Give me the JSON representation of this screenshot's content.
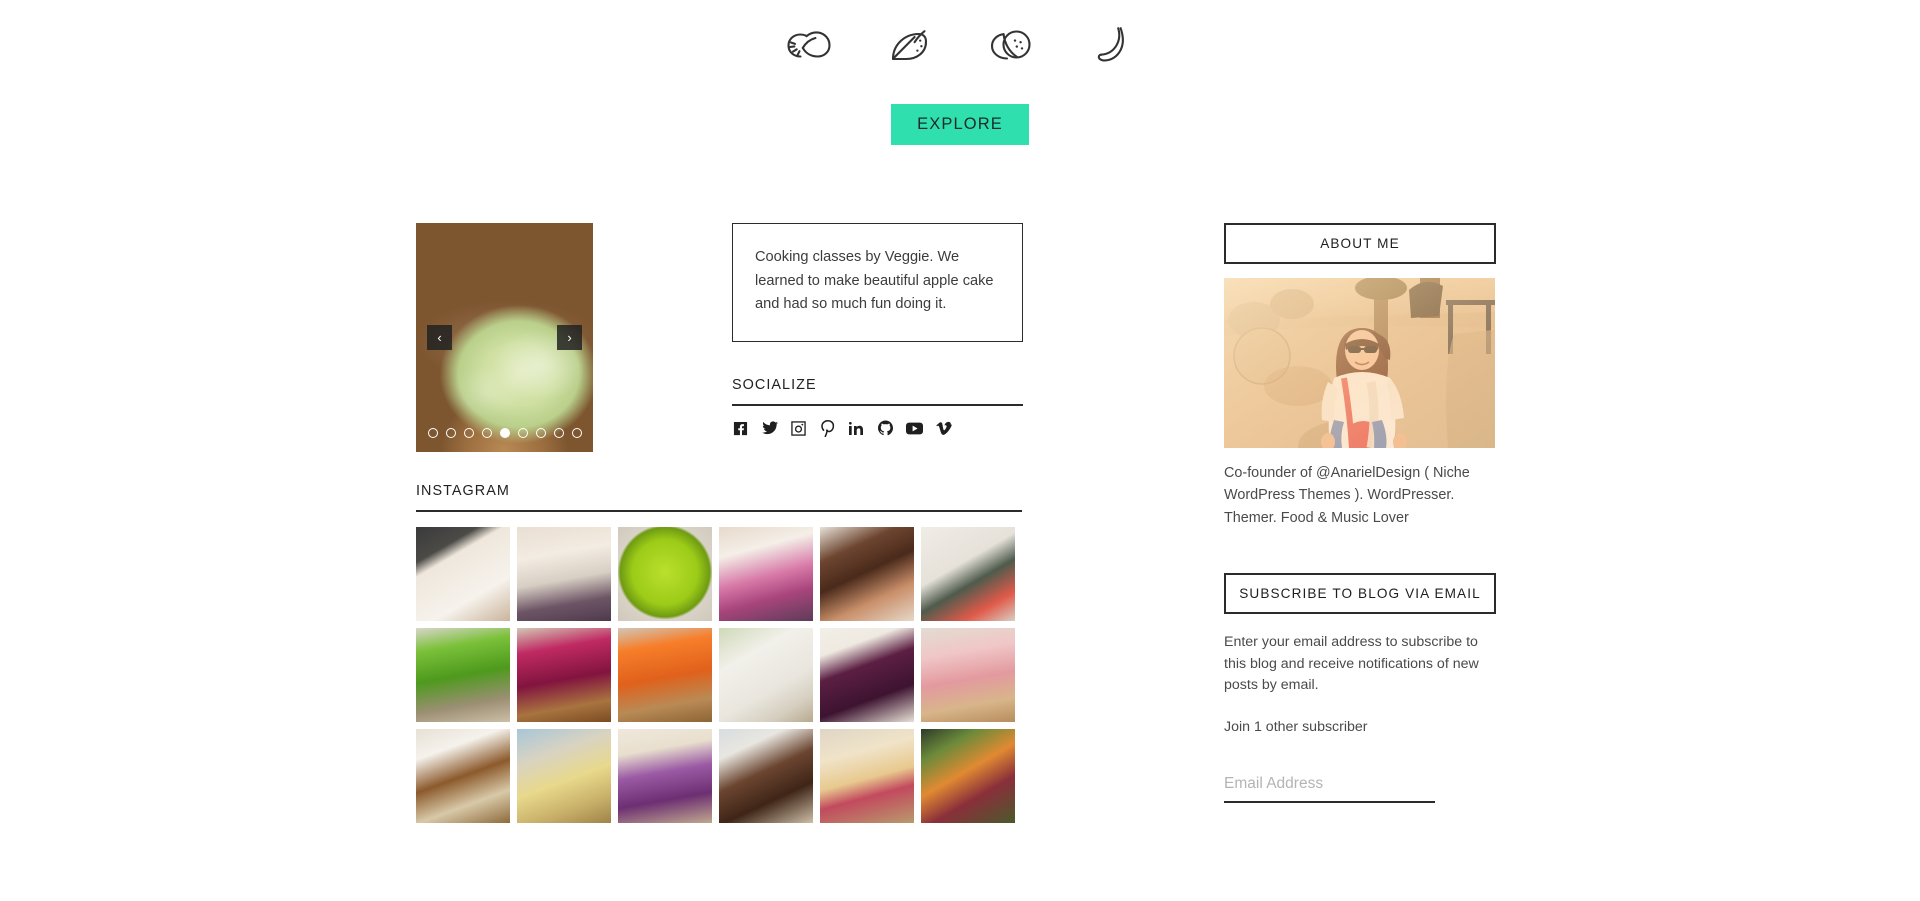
{
  "nav": {
    "icons": [
      {
        "name": "lemon-icon",
        "label": "Lemon"
      },
      {
        "name": "watermelon-icon",
        "label": "Watermelon"
      },
      {
        "name": "orange-icon",
        "label": "Orange"
      },
      {
        "name": "banana-icon",
        "label": "Banana"
      }
    ]
  },
  "hero": {
    "explore_label": "EXPLORE"
  },
  "slider": {
    "prev_glyph": "‹",
    "next_glyph": "›",
    "dot_count": 9,
    "active_dot": 5
  },
  "quote": {
    "text": "Cooking classes by Veggie. We learned to make beautiful apple cake and had so much fun doing it."
  },
  "socialize": {
    "title": "SOCIALIZE",
    "links": [
      {
        "name": "facebook-icon",
        "label": "Facebook"
      },
      {
        "name": "twitter-icon",
        "label": "Twitter"
      },
      {
        "name": "instagram-icon",
        "label": "Instagram"
      },
      {
        "name": "pinterest-icon",
        "label": "Pinterest"
      },
      {
        "name": "linkedin-icon",
        "label": "LinkedIn"
      },
      {
        "name": "github-icon",
        "label": "GitHub"
      },
      {
        "name": "youtube-icon",
        "label": "YouTube"
      },
      {
        "name": "vimeo-icon",
        "label": "Vimeo"
      }
    ]
  },
  "instagram": {
    "title": "INSTAGRAM",
    "tiles": [
      {
        "alt": "laptop-with-chocolate-cake-website"
      },
      {
        "alt": "creamy-soup-bowl-with-seeds"
      },
      {
        "alt": "green-smoothie-bowl-top-view"
      },
      {
        "alt": "kiwi-banana-pink-smoothie-bowl"
      },
      {
        "alt": "chocolate-layer-cake-slice"
      },
      {
        "alt": "tablet-showing-recipe-site"
      },
      {
        "alt": "green-smoothie-glass"
      },
      {
        "alt": "berry-smoothie-glass"
      },
      {
        "alt": "carrot-orange-juice-glass"
      },
      {
        "alt": "phone-and-laptop-recipe-app"
      },
      {
        "alt": "purple-beet-cake-slice"
      },
      {
        "alt": "pink-banana-milkshake"
      },
      {
        "alt": "coconut-topped-cake-slice"
      },
      {
        "alt": "lemon-crumb-cake-bars"
      },
      {
        "alt": "purple-berry-smoothie-glass"
      },
      {
        "alt": "chocolate-cake-slice-closeup"
      },
      {
        "alt": "crepe-roll-with-berries"
      },
      {
        "alt": "colorful-vegetable-salad"
      }
    ]
  },
  "sidebar": {
    "about": {
      "title": "ABOUT ME",
      "photo_alt": "portrait-of-woman-with-sunglasses-outdoors",
      "bio": "Co-founder of @AnarielDesign ( Niche WordPress Themes ). WordPresser. Themer. Food & Music Lover"
    },
    "subscribe": {
      "title": "SUBSCRIBE TO BLOG VIA EMAIL",
      "description": "Enter your email address to subscribe to this blog and receive notifications of new posts by email.",
      "subscriber_count": "Join 1 other subscriber",
      "email_placeholder": "Email Address",
      "email_value": ""
    }
  },
  "colors": {
    "accent": "#2fdfae",
    "ink": "#2b2b2b",
    "muted": "#4a4a4a"
  }
}
